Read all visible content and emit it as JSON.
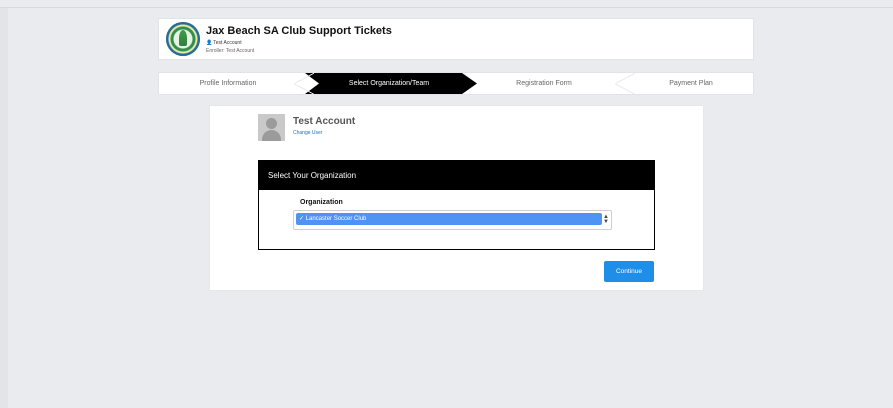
{
  "header": {
    "title": "Jax Beach SA Club Support Tickets",
    "user": "Test Account",
    "enroller": "Enroller: Test Account",
    "logo_icon": "club-logo"
  },
  "steps": [
    {
      "label": "Profile Information",
      "active": false
    },
    {
      "label": "Select Organization/Team",
      "active": true
    },
    {
      "label": "Registration Form",
      "active": false
    },
    {
      "label": "Payment Plan",
      "active": false
    }
  ],
  "account": {
    "name": "Test Account",
    "change_user": "Change User"
  },
  "organization": {
    "heading": "Select Your Organization",
    "label": "Organization",
    "selected": "✓ Lancaster Soccer Club"
  },
  "actions": {
    "continue": "Continue"
  },
  "colors": {
    "background": "#eaebef",
    "accent": "#1f8ee8",
    "active_step": "#000000",
    "selected_option": "#4f93f3"
  }
}
